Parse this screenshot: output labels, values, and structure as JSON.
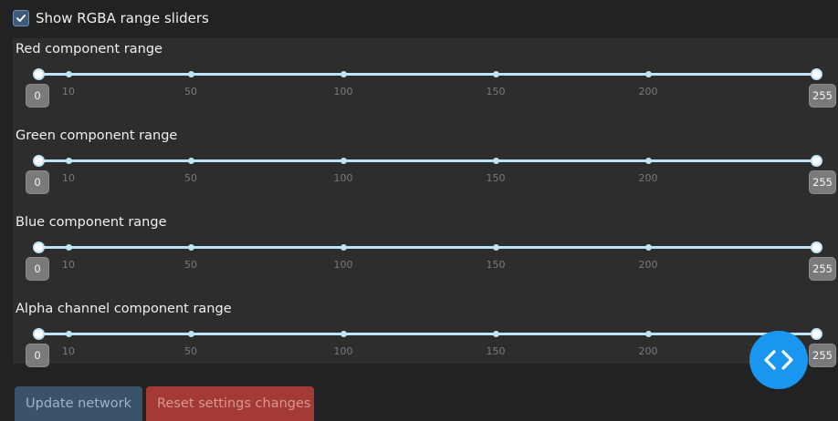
{
  "toggle": {
    "label": "Show RGBA range sliders",
    "checked": true
  },
  "sliders": [
    {
      "title": "Red component range",
      "min_value": "0",
      "max_value": "255",
      "ticks": [
        "10",
        "50",
        "100",
        "150",
        "200"
      ]
    },
    {
      "title": "Green component range",
      "min_value": "0",
      "max_value": "255",
      "ticks": [
        "10",
        "50",
        "100",
        "150",
        "200"
      ]
    },
    {
      "title": "Blue component range",
      "min_value": "0",
      "max_value": "255",
      "ticks": [
        "10",
        "50",
        "100",
        "150",
        "200"
      ]
    },
    {
      "title": "Alpha channel component range",
      "min_value": "0",
      "max_value": "255",
      "ticks": [
        "10",
        "50",
        "100",
        "150",
        "200"
      ]
    }
  ],
  "buttons": {
    "update_label": "Update network",
    "reset_label": "Reset settings changes"
  },
  "fab": {
    "icon": "code-icon",
    "color": "#1996f0"
  },
  "colors": {
    "background": "#222222",
    "panel": "#2d2d2d",
    "track": "#bfe4f5",
    "update_button": "#3a526a",
    "reset_button": "#a33a35"
  }
}
